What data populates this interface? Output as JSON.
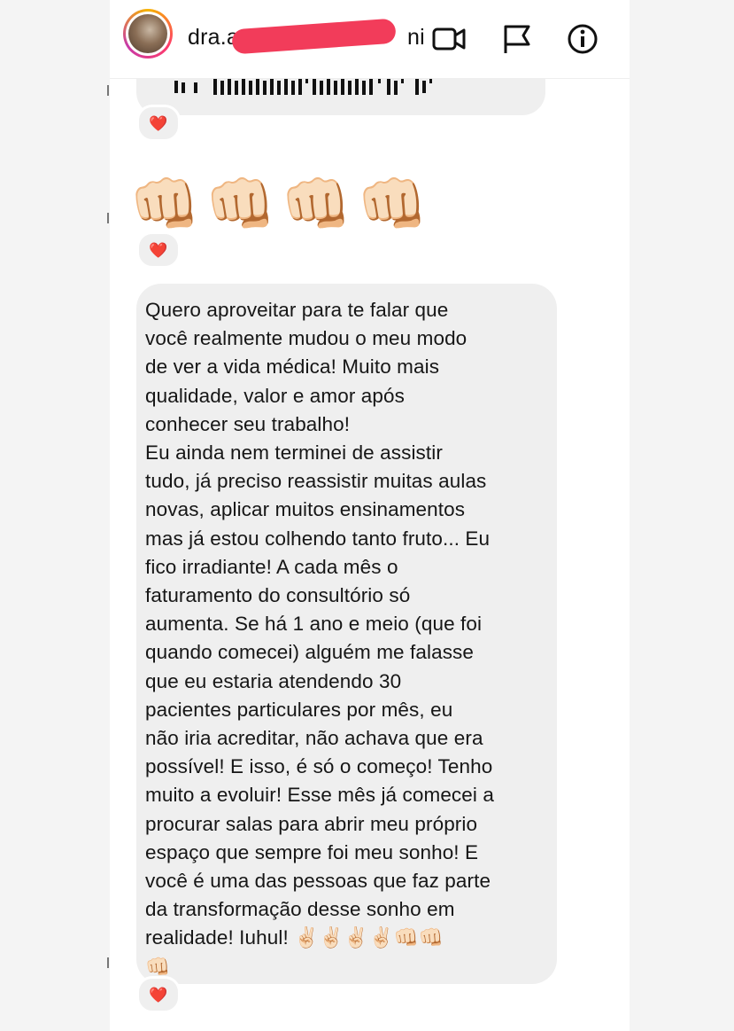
{
  "header": {
    "username_visible": "dra.a",
    "username_tail": "ni",
    "icons": [
      "video-call-icon",
      "flag-icon",
      "info-icon"
    ]
  },
  "voice_message": {
    "reaction": "❤️"
  },
  "emoji_message": {
    "content": "👊🏻👊🏻👊🏻👊🏻",
    "reaction": "❤️"
  },
  "text_message": {
    "content": "Quero aproveitar para te falar que\nvocê realmente mudou o meu modo\nde ver a vida médica! Muito mais\nqualidade, valor e amor após\nconhecer seu trabalho!\nEu ainda nem terminei de assistir\ntudo, já preciso reassistir muitas aulas\nnovas, aplicar muitos ensinamentos\nmas já estou colhendo tanto fruto... Eu\nfico irradiante! A cada mês o\nfaturamento do consultório só\naumenta. Se há 1 ano e meio (que foi\nquando comecei) alguém me falasse\nque eu estaria atendendo 30\npacientes particulares por mês, eu\nnão iria acreditar, não achava que era\npossível! E isso, é só o começo! Tenho\nmuito a evoluir! Esse mês já comecei a\nprocurar salas para abrir meu próprio\nespaço que sempre foi meu sonho! E\nvocê é uma das pessoas que faz parte\nda transformação desse sonho em\nrealidade! Iuhul! ✌🏻✌🏻✌🏻✌🏻👊🏻👊🏻\n👊🏻",
    "reaction": "❤️"
  },
  "colors": {
    "bubble_bg": "#efefef",
    "redaction": "#f23c5a",
    "heart": "#e0245e",
    "text": "#161616"
  }
}
